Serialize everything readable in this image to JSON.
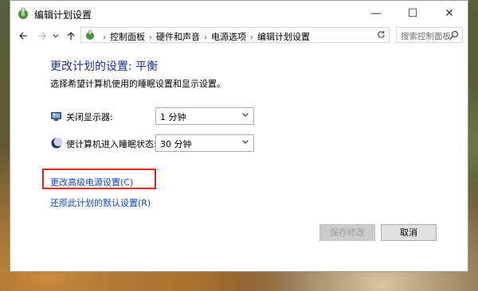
{
  "window": {
    "title": "编辑计划设置",
    "controls": {
      "minimize": "—",
      "maximize": "☐",
      "close": "✕"
    }
  },
  "nav": {
    "back_icon": "arrow-left-icon",
    "forward_icon": "arrow-right-icon",
    "recent_icon": "chevron-down-icon",
    "up_icon": "arrow-up-icon",
    "breadcrumbs": [
      "控制面板",
      "硬件和声音",
      "电源选项",
      "编辑计划设置"
    ],
    "search_placeholder": "搜索控制面板"
  },
  "main": {
    "heading": "更改计划的设置: 平衡",
    "subtitle": "选择希望计算机使用的睡眠设置和显示设置。",
    "settings": [
      {
        "label": "关闭显示器:",
        "value": "1 分钟",
        "icon": "monitor-icon"
      },
      {
        "label": "使计算机进入睡眠状态:",
        "value": "30 分钟",
        "icon": "moon-icon"
      }
    ],
    "links": {
      "advanced": "更改高级电源设置(C)",
      "restore": "还原此计划的默认设置(R)"
    },
    "buttons": {
      "save": "保存修改",
      "cancel": "取消"
    }
  },
  "colors": {
    "heading": "#1e3287",
    "link": "#0a46c8",
    "highlight": "#e0201b"
  }
}
